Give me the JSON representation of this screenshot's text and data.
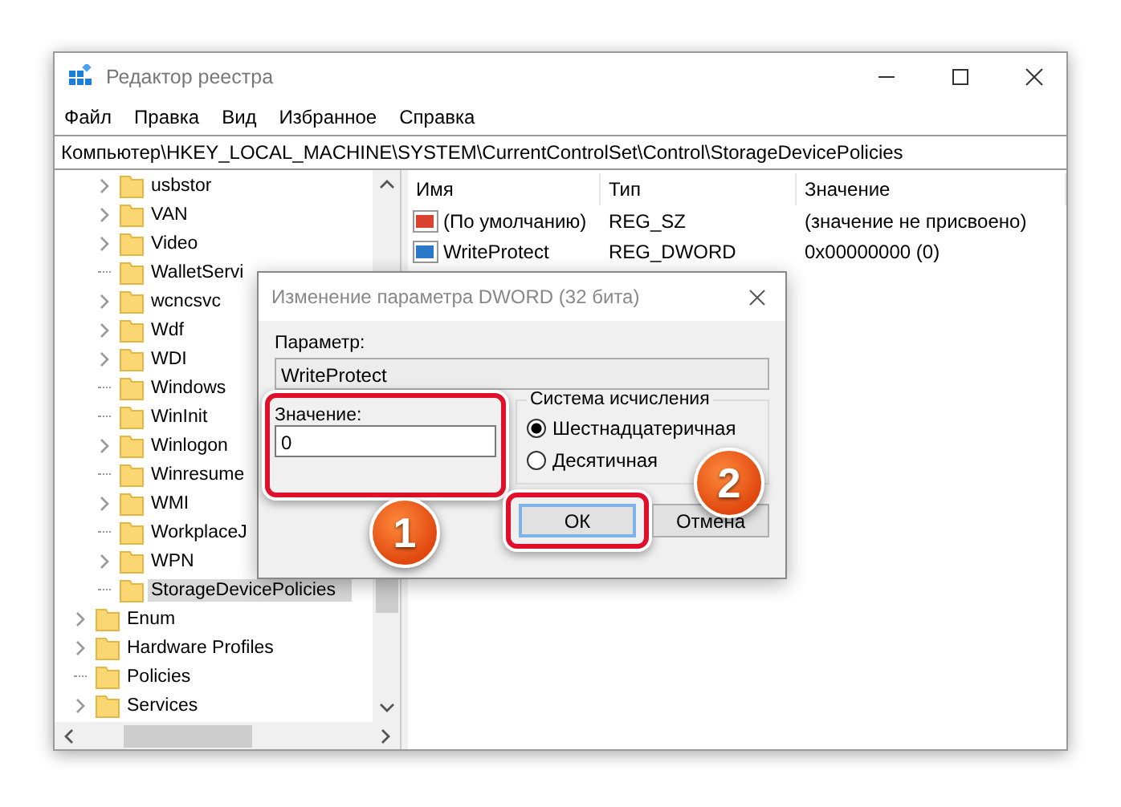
{
  "window": {
    "title": "Редактор реестра"
  },
  "menu": [
    "Файл",
    "Правка",
    "Вид",
    "Избранное",
    "Справка"
  ],
  "address": "Компьютер\\HKEY_LOCAL_MACHINE\\SYSTEM\\CurrentControlSet\\Control\\StorageDevicePolicies",
  "tree": [
    {
      "children": [
        {
          "label": "usbstor",
          "expandable": true,
          "selected": false
        },
        {
          "label": "VAN",
          "expandable": true,
          "selected": false
        },
        {
          "label": "Video",
          "expandable": true,
          "selected": false
        },
        {
          "label": "WalletServi",
          "expandable": false,
          "selected": false
        },
        {
          "label": "wcncsvc",
          "expandable": true,
          "selected": false
        },
        {
          "label": "Wdf",
          "expandable": true,
          "selected": false
        },
        {
          "label": "WDI",
          "expandable": true,
          "selected": false
        },
        {
          "label": "Windows",
          "expandable": false,
          "selected": false
        },
        {
          "label": "WinInit",
          "expandable": false,
          "selected": false
        },
        {
          "label": "Winlogon",
          "expandable": true,
          "selected": false
        },
        {
          "label": "Winresume",
          "expandable": false,
          "selected": false
        },
        {
          "label": "WMI",
          "expandable": true,
          "selected": false
        },
        {
          "label": "WorkplaceJ",
          "expandable": false,
          "selected": false
        },
        {
          "label": "WPN",
          "expandable": true,
          "selected": false
        },
        {
          "label": "StorageDevicePolicies",
          "expandable": false,
          "selected": true
        }
      ]
    },
    {
      "label": "Enum",
      "expandable": true,
      "selected": false
    },
    {
      "label": "Hardware Profiles",
      "expandable": true,
      "selected": false
    },
    {
      "label": "Policies",
      "expandable": false,
      "selected": false
    },
    {
      "label": "Services",
      "expandable": true,
      "selected": false
    }
  ],
  "list": {
    "columns": [
      "Имя",
      "Тип",
      "Значение"
    ],
    "rows": [
      {
        "kind": "string",
        "name": "(По умолчанию)",
        "type": "REG_SZ",
        "value": "(значение не присвоено)"
      },
      {
        "kind": "dword",
        "name": "WriteProtect",
        "type": "REG_DWORD",
        "value": "0x00000000 (0)"
      }
    ]
  },
  "dialog": {
    "title": "Изменение параметра DWORD (32 бита)",
    "param_label": "Параметр:",
    "param_value": "WriteProtect",
    "value_label": "Значение:",
    "value": "0",
    "base_group": "Система исчисления",
    "bases": [
      {
        "label": "Шестнадцатеричная",
        "selected": true
      },
      {
        "label": "Десятичная",
        "selected": false
      }
    ],
    "buttons": [
      {
        "label": "ОК",
        "default": true
      },
      {
        "label": "Отмена",
        "default": false
      }
    ]
  },
  "badges": [
    "1",
    "2"
  ]
}
